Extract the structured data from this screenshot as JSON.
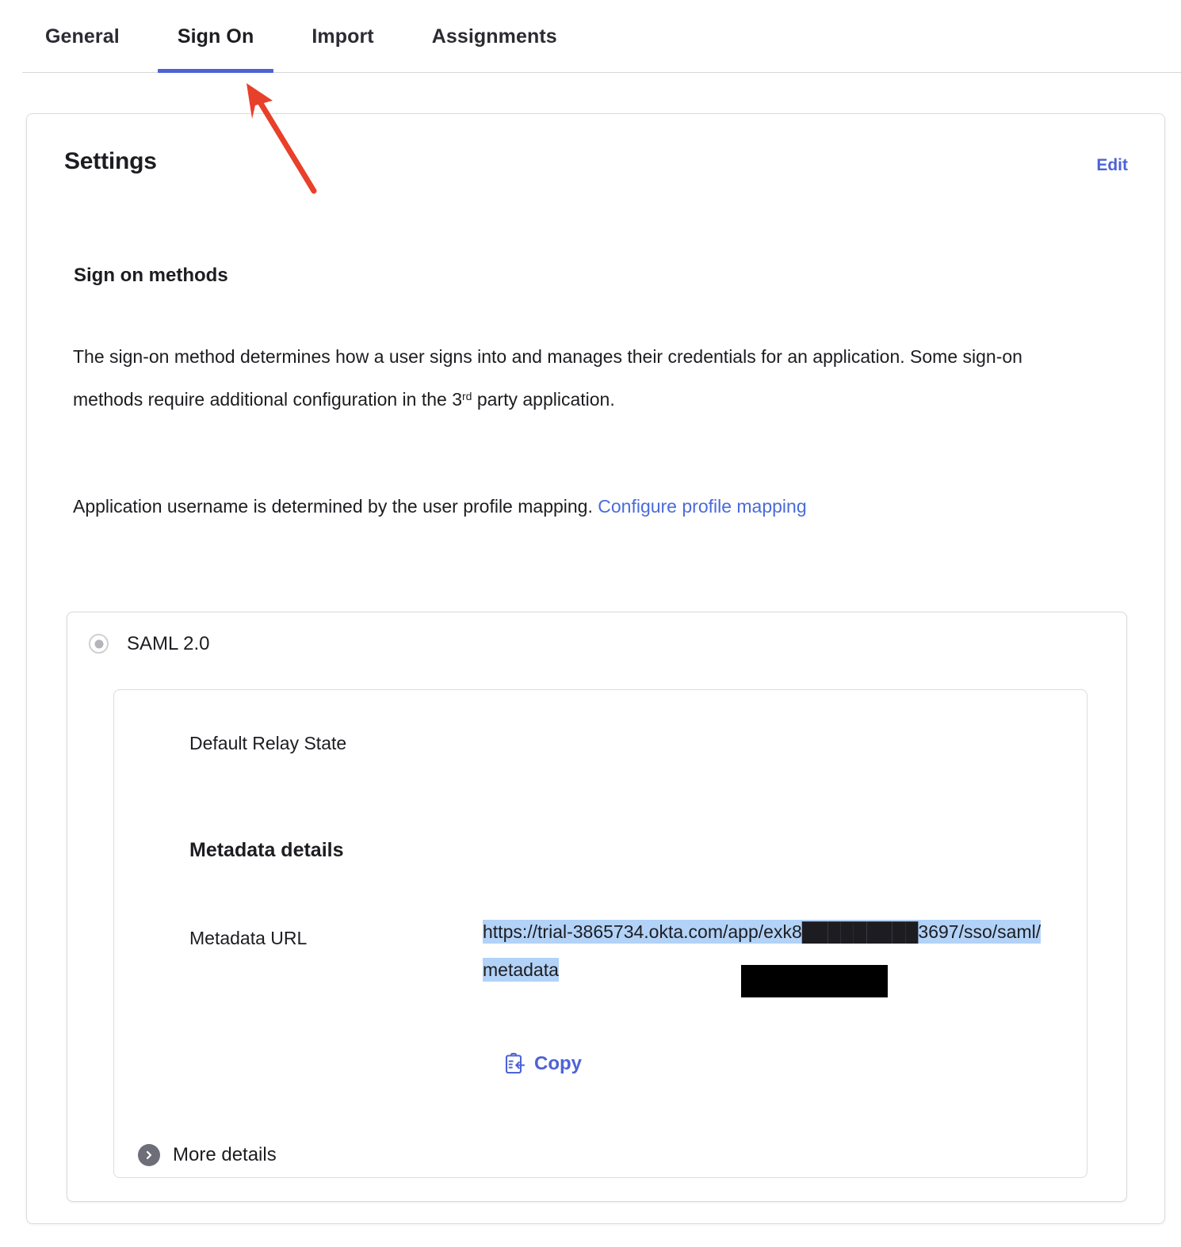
{
  "tabs": [
    {
      "label": "General",
      "active": false
    },
    {
      "label": "Sign On",
      "active": true
    },
    {
      "label": "Import",
      "active": false
    },
    {
      "label": "Assignments",
      "active": false
    }
  ],
  "card": {
    "title": "Settings",
    "edit_label": "Edit"
  },
  "signon": {
    "section_title": "Sign on methods",
    "paragraph_1_a": "The sign-on method determines how a user signs into and manages their credentials for an application. Some sign-on methods require additional configuration in the 3",
    "paragraph_1_sup": "rd",
    "paragraph_1_b": " party application.",
    "paragraph_2_a": "Application username is determined by the user profile mapping. ",
    "profile_mapping_link": "Configure profile mapping",
    "method_label": "SAML 2.0",
    "method_selected": true
  },
  "metadata": {
    "relay_state_label": "Default Relay State",
    "relay_state_value": "",
    "heading": "Metadata details",
    "url_label": "Metadata URL",
    "url_value_part_1": "https://trial-3865734.okta.com/app/exk8",
    "url_value_redacted": "█████████",
    "url_value_part_2": "3697/sso/saml/metadata",
    "copy_label": "Copy",
    "more_details_label": "More details"
  },
  "icons": {
    "copy": "clipboard-copy-icon",
    "more_details": "chevron-right-circle-icon",
    "tab_underline": "active-tab-indicator"
  },
  "colors": {
    "accent_blue": "#4d63d5",
    "link_blue": "#4a6bdb",
    "selection_highlight": "#b2d2f7",
    "redaction": "#000000",
    "annotation_arrow": "#e8402a",
    "card_border": "#dcdce0",
    "text": "#1d1d21"
  },
  "annotation": {
    "type": "arrow",
    "points_to": "sign-on-tab"
  }
}
